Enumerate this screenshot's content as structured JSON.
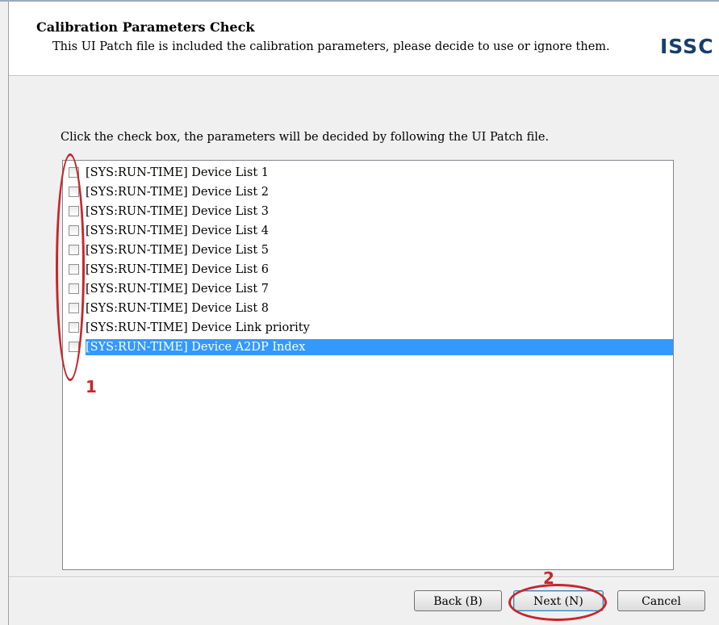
{
  "header": {
    "title": "Calibration Parameters Check",
    "subtitle": "This UI Patch file is included the calibration parameters, please decide to use or ignore them.",
    "logo_text": "ISSC"
  },
  "instruction": "Click the check box, the parameters will be decided by following the UI Patch file.",
  "list": {
    "items": [
      {
        "label": "[SYS:RUN-TIME] Device List 1",
        "checked": false,
        "selected": false
      },
      {
        "label": "[SYS:RUN-TIME] Device List 2",
        "checked": false,
        "selected": false
      },
      {
        "label": "[SYS:RUN-TIME] Device List 3",
        "checked": false,
        "selected": false
      },
      {
        "label": "[SYS:RUN-TIME] Device List 4",
        "checked": false,
        "selected": false
      },
      {
        "label": "[SYS:RUN-TIME] Device List 5",
        "checked": false,
        "selected": false
      },
      {
        "label": "[SYS:RUN-TIME] Device List 6",
        "checked": false,
        "selected": false
      },
      {
        "label": "[SYS:RUN-TIME] Device List 7",
        "checked": false,
        "selected": false
      },
      {
        "label": "[SYS:RUN-TIME] Device List 8",
        "checked": false,
        "selected": false
      },
      {
        "label": "[SYS:RUN-TIME] Device Link priority",
        "checked": false,
        "selected": false
      },
      {
        "label": "[SYS:RUN-TIME] Device A2DP Index",
        "checked": false,
        "selected": true
      }
    ]
  },
  "annotations": {
    "marker_1": "1",
    "marker_2": "2",
    "color": "#c8262a"
  },
  "buttons": {
    "back": "Back (B)",
    "next": "Next (N)",
    "cancel": "Cancel"
  },
  "colors": {
    "selection": "#3399ff",
    "logo": "#163f6e"
  }
}
